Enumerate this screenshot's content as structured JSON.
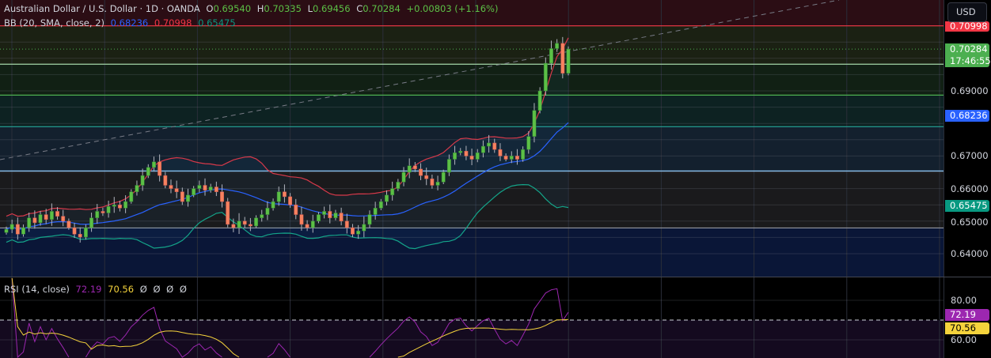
{
  "header": {
    "symbol": "Australian Dollar / U.S. Dollar · 1D · OANDA",
    "o_label": "O",
    "o": "0.69540",
    "h_label": "H",
    "h": "0.70335",
    "l_label": "L",
    "l": "0.69456",
    "c_label": "C",
    "c": "0.70284",
    "change": "+0.00803 (+1.16%)"
  },
  "bb": {
    "label": "BB (20, SMA, close, 2)",
    "basis": "0.68236",
    "upper": "0.70998",
    "lower": "0.65475"
  },
  "rsi": {
    "label": "RSI (14, close)",
    "rsi": "72.19",
    "ma": "70.56",
    "empties": [
      "Ø",
      "Ø",
      "Ø",
      "Ø"
    ]
  },
  "currency_button": "USD",
  "countdown": "17:46:55",
  "colors": {
    "up": "#5cc046",
    "down": "#f7825f",
    "upper": "#d8394a",
    "basis": "#2962ff",
    "lower": "#14a58a",
    "rsi": "#9c27b0",
    "rsi_ma": "#f5d33c"
  },
  "chart_data": {
    "type": "candlestick",
    "title": "Australian Dollar / U.S. Dollar · 1D · OANDA",
    "ylim": [
      0.6335,
      0.7145
    ],
    "price_ticks": [
      "0.69000",
      "0.67000",
      "0.66000",
      "0.65000",
      "0.64000"
    ],
    "rsi_ticks": [
      "80.00",
      "60.00"
    ],
    "zones": [
      {
        "price": 0.70998,
        "color": "#f23645"
      },
      {
        "price": 0.6982,
        "color": "#a5d6a7"
      },
      {
        "price": 0.6887,
        "color": "#4caf50"
      },
      {
        "price": 0.679,
        "color": "#26a69a"
      },
      {
        "price": 0.6654,
        "color": "#90caf9"
      },
      {
        "price": 0.6479,
        "color": "#9598a1"
      }
    ],
    "closes": [
      0.6475,
      0.649,
      0.646,
      0.648,
      0.651,
      0.6495,
      0.652,
      0.6505,
      0.653,
      0.6515,
      0.65,
      0.648,
      0.646,
      0.6451,
      0.648,
      0.651,
      0.653,
      0.6525,
      0.6545,
      0.655,
      0.654,
      0.656,
      0.659,
      0.661,
      0.664,
      0.6665,
      0.6682,
      0.664,
      0.661,
      0.66,
      0.659,
      0.656,
      0.658,
      0.66,
      0.661,
      0.6595,
      0.6605,
      0.659,
      0.656,
      0.649,
      0.648,
      0.65,
      0.649,
      0.6485,
      0.651,
      0.652,
      0.654,
      0.656,
      0.659,
      0.6575,
      0.655,
      0.652,
      0.649,
      0.648,
      0.65,
      0.652,
      0.653,
      0.651,
      0.6525,
      0.65,
      0.648,
      0.646,
      0.647,
      0.649,
      0.652,
      0.654,
      0.656,
      0.658,
      0.66,
      0.662,
      0.665,
      0.667,
      0.666,
      0.664,
      0.663,
      0.661,
      0.662,
      0.665,
      0.669,
      0.671,
      0.6715,
      0.67,
      0.669,
      0.671,
      0.673,
      0.674,
      0.672,
      0.67,
      0.669,
      0.67,
      0.669,
      0.672,
      0.676,
      0.684,
      0.69,
      0.6985,
      0.703,
      0.7046,
      0.6954,
      0.70284
    ]
  }
}
